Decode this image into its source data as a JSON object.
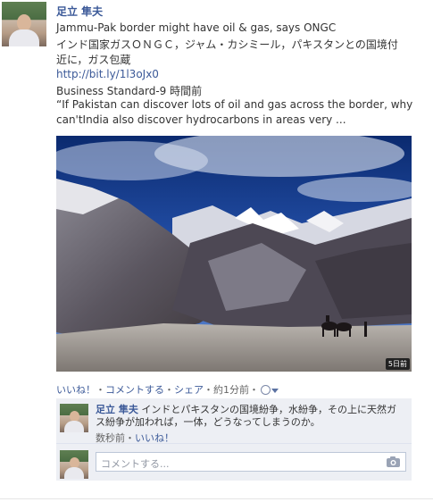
{
  "post": {
    "author": "足立 隼夫",
    "title_en": "Jammu-Pak border might have oil & gas, says ONGC",
    "title_jp_line1": "インド国家ガスＯＮＧＣ，ジャム・カシミール，パキスタンとの国境付",
    "title_jp_line2": "近に，ガス包蔵",
    "link": "http://bit.ly/1l3oJx0",
    "source": "Business Standard-9 時間前",
    "quote_line1": "“If Pakistan can discover lots of oil and gas across the border, why",
    "quote_line2": "can'tIndia also discover hydrocarbons in areas very ...",
    "photo_badge": "5日前"
  },
  "actions": {
    "like": "いいね！",
    "comment": "コメントする",
    "share": "シェア",
    "time": "約1分前"
  },
  "comment": {
    "author": "足立 隼夫",
    "text_after_author": "インドとパキスタンの国境紛争，水紛争，その上に天然ガス紛争が加われば，一体，どうなってしまうのか。",
    "time": "数秒前",
    "like": "いいね！"
  },
  "comment_input": {
    "placeholder": "コメントする..."
  },
  "icons": {
    "privacy": "globe-icon",
    "privacy_menu": "chevron-down-icon",
    "photo_attach": "camera-icon"
  },
  "colors": {
    "link": "#3b5998",
    "comment_bg": "#edeff4"
  }
}
